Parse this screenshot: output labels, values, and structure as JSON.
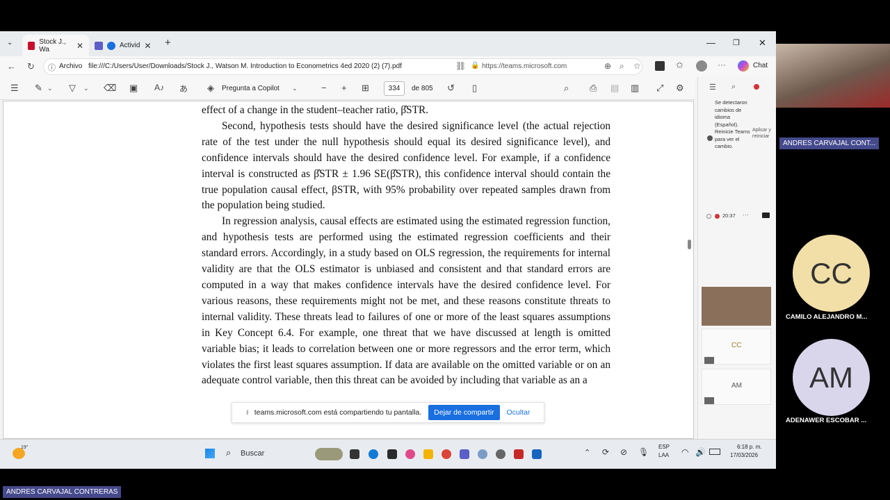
{
  "browser": {
    "tabs": [
      {
        "label": "Stock J., Wa"
      },
      {
        "label": "Activid"
      }
    ],
    "address": {
      "scheme_label": "Archivo",
      "url": "file:///C:/Users/User/Downloads/Stock J., Watson M. Introduction to Econometrics 4ed 2020 (2) (7).pdf",
      "secondary_url": "https://teams.microsoft.com",
      "chat_label": "Chat"
    }
  },
  "pdf_toolbar": {
    "copilot_label": "Pregunta a Copilot",
    "page_current": "334",
    "page_total": "de 805"
  },
  "pdf": {
    "paragraphs": [
      {
        "text": "effect of a change in the student–teacher ratio, β̂STR.",
        "indent": false
      },
      {
        "text": "Second, hypothesis tests should have the desired significance level (the actual rejection rate of the test under the null hypothesis should equal its desired significance level), and confidence intervals should have the desired confidence level. For example, if a confidence interval is constructed as β̂STR ± 1.96 SE(β̂STR), this confidence interval should contain the true population causal effect, βSTR, with 95% probability over repeated samples drawn from the population being studied.",
        "indent": true
      },
      {
        "text": "In regression analysis, causal effects are estimated using the estimated regression function, and hypothesis tests are performed using the estimated regression coefficients and their standard errors. Accordingly, in a study based on OLS regression, the requirements for internal validity are that the OLS estimator is unbiased and consistent and that standard errors are computed in a way that makes confidence intervals have the desired confidence level. For various reasons, these requirements might not be met, and these reasons constitute threats to internal validity. These threats lead to failures of one or more of the least squares assumptions in Key Concept 6.4. For example, one threat that we have discussed at length is omitted variable bias; it leads to correlation between one or more regressors and the error term, which violates the first least squares assumption. If data are available on the omitted variable or on an adequate control variable, then this threat can be avoided by including that variable as an a",
        "indent": true
      }
    ]
  },
  "share_bar": {
    "message": "teams.microsoft.com está compartiendo tu pantalla.",
    "stop_label": "Dejar de compartir",
    "hide_label": "Ocultar"
  },
  "teams_panel": {
    "notification": "Se detectaron cambios de idioma (Español). Reinicie Teams para ver el cambio.",
    "apply_label": "Aplicar y reiniciar",
    "time": "20:37",
    "tiles": [
      {
        "initials": "CC"
      },
      {
        "initials": "AM"
      }
    ]
  },
  "taskbar": {
    "weather": "19°",
    "search_label": "Buscar",
    "lang_top": "ESP",
    "lang_bottom": "LAA",
    "time": "6:18 p. m.",
    "date": "17/03/2026"
  },
  "meeting": {
    "presenter_name": "ANDRES CARVAJAL CONT...",
    "participants": [
      {
        "initials": "CC",
        "name": "CAMILO ALEJANDRO M...",
        "color": "#f2dfa7"
      },
      {
        "initials": "AM",
        "name": "ADENAWER ESCOBAR ...",
        "color": "#d9d6ec"
      }
    ],
    "self_name": "ANDRES CARVAJAL CONTRERAS"
  },
  "colors": {
    "accent": "#1a6fe0",
    "name_bar": "#454a8c"
  }
}
